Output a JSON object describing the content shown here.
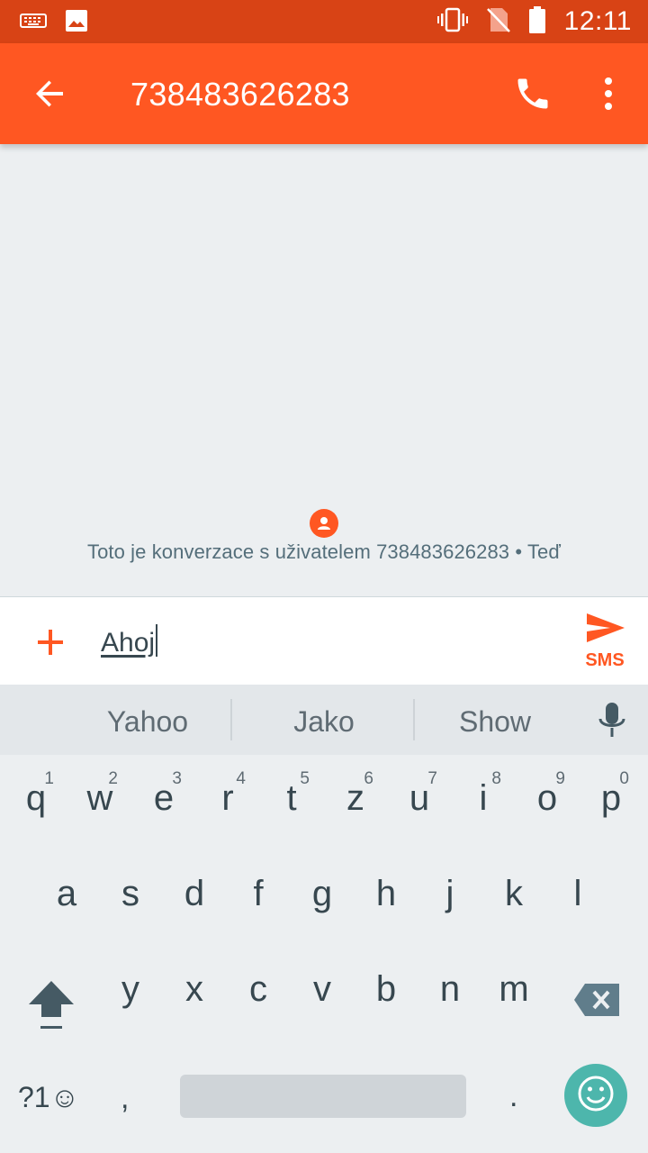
{
  "status_bar": {
    "time": "12:11",
    "icons": [
      "keyboard-icon",
      "image-icon",
      "vibrate-icon",
      "no-sim-icon",
      "battery-icon"
    ],
    "background": "#d84315"
  },
  "app_bar": {
    "title": "738483626283",
    "background": "#ff5722",
    "icons": [
      "back-arrow-icon",
      "phone-icon",
      "more-vert-icon"
    ]
  },
  "conversation": {
    "info_text": "Toto je konverzace s uživatelem 738483626283 • Teď"
  },
  "compose": {
    "message_text": "Ahoj",
    "send_label": "SMS",
    "accent": "#ff5722"
  },
  "suggestions": [
    "Yahoo",
    "Jako",
    "Show"
  ],
  "keyboard": {
    "row1": [
      {
        "key": "q",
        "hint": "1"
      },
      {
        "key": "w",
        "hint": "2"
      },
      {
        "key": "e",
        "hint": "3"
      },
      {
        "key": "r",
        "hint": "4"
      },
      {
        "key": "t",
        "hint": "5"
      },
      {
        "key": "z",
        "hint": "6"
      },
      {
        "key": "u",
        "hint": "7"
      },
      {
        "key": "i",
        "hint": "8"
      },
      {
        "key": "o",
        "hint": "9"
      },
      {
        "key": "p",
        "hint": "0"
      }
    ],
    "row2": [
      "a",
      "s",
      "d",
      "f",
      "g",
      "h",
      "j",
      "k",
      "l"
    ],
    "row3": [
      "y",
      "x",
      "c",
      "v",
      "b",
      "n",
      "m"
    ],
    "symbols_label": "?1☺",
    "comma": ",",
    "period": ".",
    "emoji_color": "#4db6ac"
  }
}
